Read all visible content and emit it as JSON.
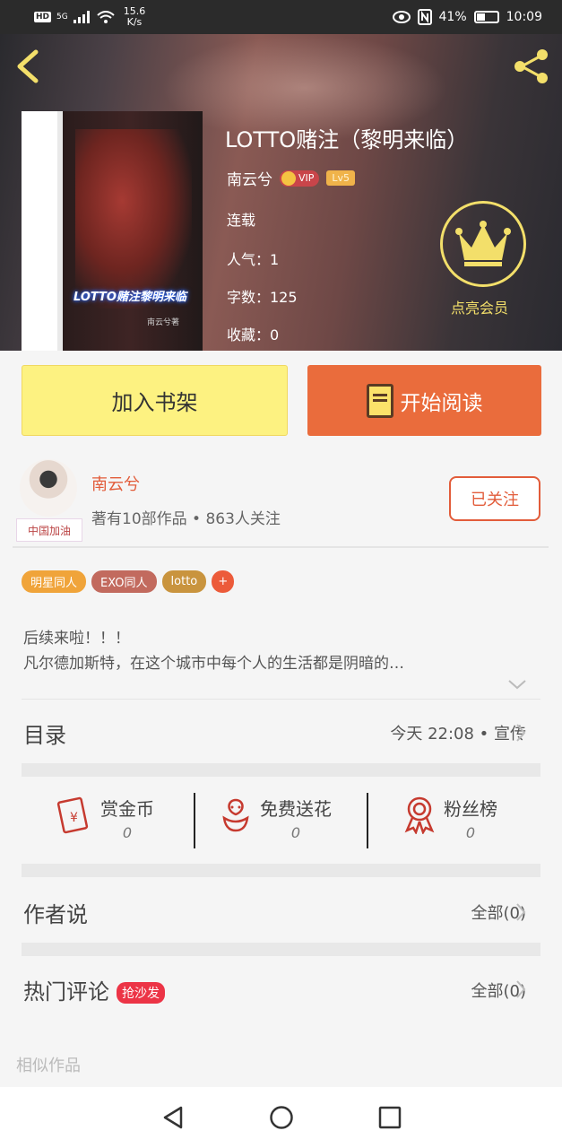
{
  "status_bar": {
    "hd": "HD",
    "signal": "5G",
    "speed": "15.6",
    "speed_unit": "K/s",
    "battery": "41%",
    "time": "10:09",
    "battery_level": 0.41
  },
  "book": {
    "title": "LOTTO赌注（黎明来临）",
    "author": "南云兮",
    "vip_label": "VIP",
    "level": "Lv5",
    "status": "连载",
    "popularity": "人气：1",
    "word_count": "字数：125",
    "favorites": "收藏：0",
    "cover_title": "LOTTO赌注黎明来临",
    "cover_author": "南云兮著",
    "vip_promo": "点亮会员"
  },
  "buttons": {
    "add_shelf": "加入书架",
    "start_read": "开始阅读"
  },
  "author": {
    "name": "南云兮",
    "stats": "著有10部作品 • 863人关注",
    "follow": "已关注",
    "avatar_tag": "中国加油"
  },
  "tags": [
    {
      "label": "明星同人",
      "color": "#f0a43a"
    },
    {
      "label": "EXO同人",
      "color": "#c26a5e"
    },
    {
      "label": "lotto",
      "color": "#c9943e"
    }
  ],
  "tag_more": "+",
  "description": {
    "line1": "后续来啦！！！",
    "line2": "凡尔德加斯特，在这个城市中每个人的生活都是阴暗的…"
  },
  "catalog": {
    "label": "目录",
    "update": "今天 22:08 • 宣传"
  },
  "actions": [
    {
      "label": "赏金币",
      "value": "0",
      "icon": "red-envelope-icon"
    },
    {
      "label": "免费送花",
      "value": "0",
      "icon": "flower-icon"
    },
    {
      "label": "粉丝榜",
      "value": "0",
      "icon": "medal-icon"
    }
  ],
  "author_says": {
    "label": "作者说",
    "all": "全部(0)"
  },
  "hot_comments": {
    "label": "热门评论",
    "badge": "抢沙发",
    "all": "全部(0)"
  },
  "similar": "相似作品",
  "colors": {
    "accent": "#ea6c3c",
    "shelf": "#fdf281",
    "gold": "#f3df6a"
  }
}
